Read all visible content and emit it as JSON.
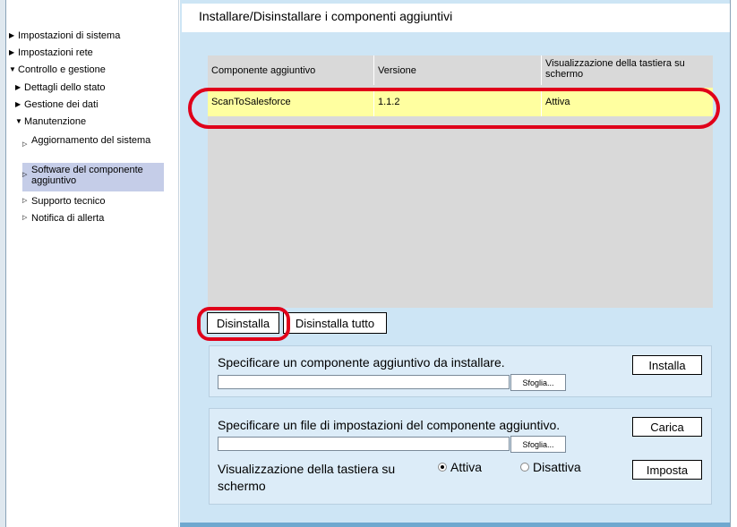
{
  "sidebar": {
    "items": [
      {
        "label": "Impostazioni di sistema",
        "icon": "triangle-right-icon"
      },
      {
        "label": "Impostazioni rete",
        "icon": "triangle-right-icon"
      },
      {
        "label": "Controllo e gestione",
        "icon": "triangle-down-icon"
      },
      {
        "label": "Dettagli dello stato",
        "icon": "triangle-right-icon"
      },
      {
        "label": "Gestione dei dati",
        "icon": "triangle-right-icon"
      },
      {
        "label": "Manutenzione",
        "icon": "triangle-down-icon"
      },
      {
        "label": "Aggiornamento del sistema",
        "icon": "small-triangle-right-icon"
      },
      {
        "label": "Software del componente aggiuntivo",
        "icon": "small-triangle-right-icon",
        "selected": true
      },
      {
        "label": "Supporto tecnico",
        "icon": "small-triangle-right-icon"
      },
      {
        "label": "Notifica di allerta",
        "icon": "small-triangle-right-icon"
      }
    ]
  },
  "main": {
    "title": "Installare/Disinstallare i componenti aggiuntivi",
    "table": {
      "headers": [
        "Componente aggiuntivo",
        "Versione",
        "Visualizzazione della tastiera su schermo"
      ],
      "rows": [
        [
          "ScanToSalesforce",
          "1.1.2",
          "Attiva"
        ]
      ]
    },
    "buttons": {
      "uninstall": "Disinstalla",
      "uninstall_all": "Disinstalla tutto"
    },
    "install_panel": {
      "label": "Specificare un componente aggiuntivo da installare.",
      "file_value": "",
      "browse": "Sfoglia...",
      "install": "Installa"
    },
    "settings_panel": {
      "label": "Specificare un file di impostazioni del componente aggiuntivo.",
      "file_value": "",
      "browse": "Sfoglia...",
      "load": "Carica",
      "keyboard_label": "Visualizzazione della tastiera su schermo",
      "option_on": "Attiva",
      "option_off": "Disattiva",
      "selected": "Attiva",
      "set": "Imposta"
    }
  },
  "colors": {
    "highlight": "#e0001a",
    "selected_row": "#ffffa0",
    "main_bg": "#cde5f5"
  }
}
